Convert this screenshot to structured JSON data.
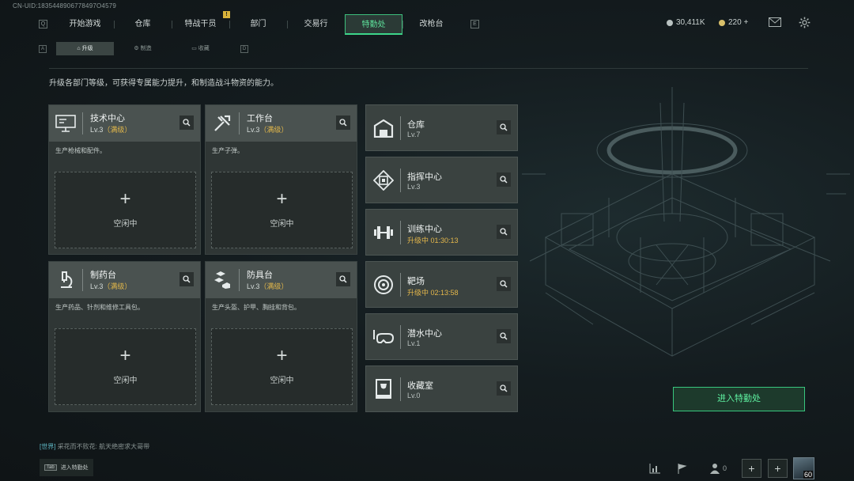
{
  "uid": "CN-UID:1835448906778497O4579",
  "top_nav": {
    "left_key": "Q",
    "right_key": "E",
    "tabs": [
      {
        "label": "开始游戏"
      },
      {
        "label": "仓库"
      },
      {
        "label": "特战干员"
      },
      {
        "label": "部门"
      },
      {
        "label": "交易行"
      },
      {
        "label": "特勤处",
        "active": true
      },
      {
        "label": "改枪台"
      }
    ],
    "alert_badge": "!"
  },
  "currency": {
    "silver": "30,411K",
    "gold": "220 +"
  },
  "sub_nav": {
    "left_key": "A",
    "right_key": "D",
    "tabs": [
      {
        "label": "升级",
        "active": true
      },
      {
        "label": "制造"
      },
      {
        "label": "收藏"
      }
    ]
  },
  "description": "升级各部门等级，可获得专属能力提升，和制造战斗物资的能力。",
  "workstations": [
    {
      "name": "技术中心",
      "level": "Lv.3",
      "level_tag": "（满级）",
      "desc": "生产枪械和配件。",
      "slot_plus": "+",
      "slot_status": "空闲中",
      "icon": "computer-icon"
    },
    {
      "name": "工作台",
      "level": "Lv.3",
      "level_tag": "（满级）",
      "desc": "生产子弹。",
      "slot_plus": "+",
      "slot_status": "空闲中",
      "icon": "tools-icon"
    },
    {
      "name": "制药台",
      "level": "Lv.3",
      "level_tag": "（满级）",
      "desc": "生产药品、针剂和维修工具包。",
      "slot_plus": "+",
      "slot_status": "空闲中",
      "icon": "microscope-icon"
    },
    {
      "name": "防具台",
      "level": "Lv.3",
      "level_tag": "（满级）",
      "desc": "生产头盔、护甲、胸挂和背包。",
      "slot_plus": "+",
      "slot_status": "空闲中",
      "icon": "armor-icon"
    }
  ],
  "facilities": [
    {
      "name": "仓库",
      "status": "Lv.7",
      "upgrading": false,
      "icon": "warehouse-icon"
    },
    {
      "name": "指挥中心",
      "status": "Lv.3",
      "upgrading": false,
      "icon": "chip-icon"
    },
    {
      "name": "训练中心",
      "status": "升级中 01:30:13",
      "upgrading": true,
      "icon": "dumbbell-icon"
    },
    {
      "name": "靶场",
      "status": "升级中 02:13:58",
      "upgrading": true,
      "icon": "target-icon"
    },
    {
      "name": "潜水中心",
      "status": "Lv.1",
      "upgrading": false,
      "icon": "diving-mask-icon"
    },
    {
      "name": "收藏室",
      "status": "Lv.0",
      "upgrading": false,
      "icon": "trophy-case-icon"
    }
  ],
  "enter_button": "进入特勤处",
  "chat": {
    "channel": "[世界]",
    "message": "采花而不败花: 航天绝密求大哥带"
  },
  "tab_hint": {
    "key": "Tab",
    "label": "进入特勤处"
  },
  "bottom_bar": {
    "friends_count": "0",
    "add_label": "+",
    "avatar_level": "60"
  },
  "colors": {
    "accent_green": "#3dd58a",
    "level_gold": "#e0b64a",
    "panel": "#2f3635"
  }
}
